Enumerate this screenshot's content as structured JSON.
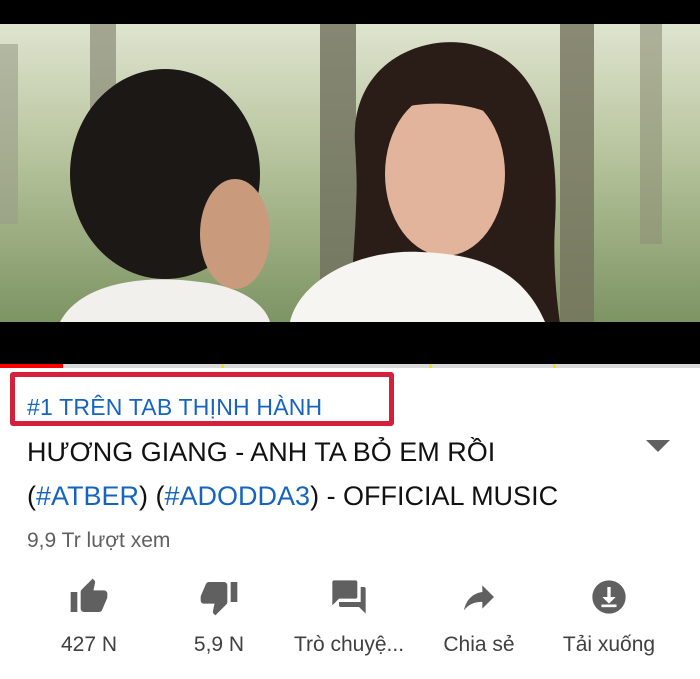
{
  "video": {
    "progress_fraction": 0.09
  },
  "trending_badge": "#1 TRÊN TAB THỊNH HÀNH",
  "title": {
    "line1": "HƯƠNG GIANG - ANH TA BỎ EM RỒI",
    "tag1": "#ATBER",
    "tag2": "#ADODDA3",
    "line2_rest": " - OFFICIAL MUSIC"
  },
  "views": "9,9 Tr lượt xem",
  "actions": {
    "like": {
      "label": "427 N",
      "icon": "thumb-up-icon"
    },
    "dislike": {
      "label": "5,9 N",
      "icon": "thumb-down-icon"
    },
    "chat": {
      "label": "Trò chuyệ...",
      "icon": "chat-icon"
    },
    "share": {
      "label": "Chia sẻ",
      "icon": "share-icon"
    },
    "download": {
      "label": "Tải xuống",
      "icon": "download-icon"
    }
  },
  "colors": {
    "link": "#1565c0",
    "highlight": "#d4203a",
    "progress": "#ff0000",
    "ad_marker": "#f3e300"
  }
}
